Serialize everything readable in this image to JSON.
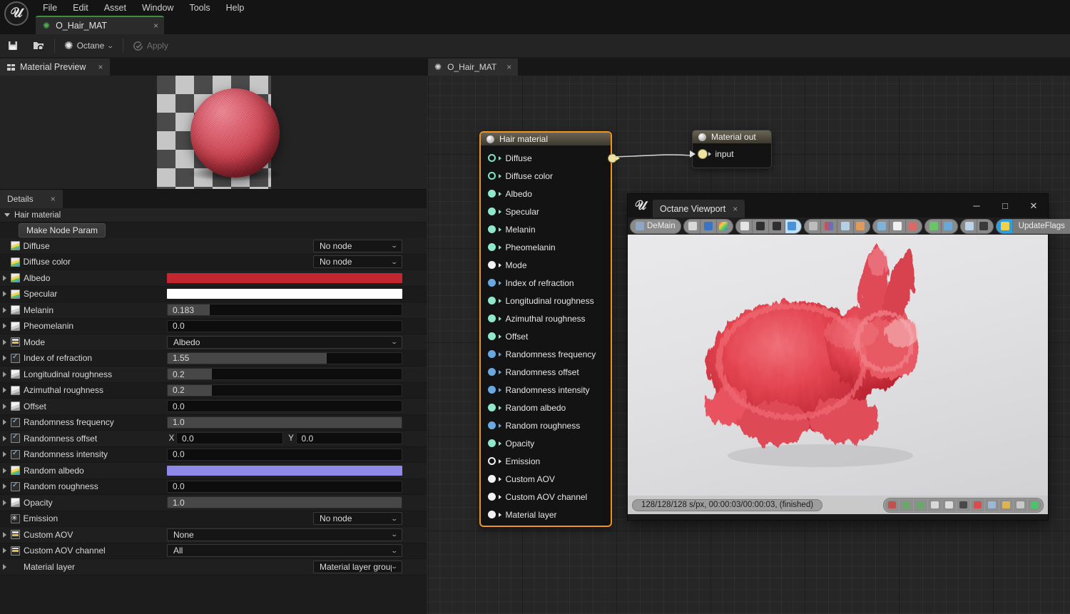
{
  "app": {
    "logo": "unreal-u-glyph",
    "menu": [
      "File",
      "Edit",
      "Asset",
      "Window",
      "Tools",
      "Help"
    ],
    "asset_tab": {
      "label": "O_Hair_MAT",
      "close": "×",
      "icon": "octane-gear-icon"
    }
  },
  "toolbar": {
    "save_label": "",
    "save_icon": "save-icon",
    "browse_icon": "browse-content-icon",
    "octane_label": "Octane",
    "octane_icon": "octane-logo-icon",
    "octane_chevron": "⌄",
    "apply_label": "Apply",
    "apply_icon": "apply-check-icon"
  },
  "preview_panel": {
    "tab_label": "Material Preview",
    "tab_close": "×",
    "tab_icon": "grid-icon"
  },
  "details_panel": {
    "tab_label": "Details",
    "tab_close": "×",
    "category": "Hair material",
    "make_node_param": "Make Node Param",
    "rows": [
      {
        "name": "Diffuse",
        "icon": "gradient-thumb-icon",
        "expand": false,
        "type": "combo",
        "value": "No node",
        "align": "right"
      },
      {
        "name": "Diffuse color",
        "icon": "gradient-thumb-icon",
        "expand": false,
        "type": "combo",
        "value": "No node",
        "align": "right"
      },
      {
        "name": "Albedo",
        "icon": "gradient-thumb-icon",
        "expand": true,
        "type": "color",
        "value": "#c42630"
      },
      {
        "name": "Specular",
        "icon": "gradient-thumb-icon",
        "expand": true,
        "type": "color",
        "value": "#ffffff"
      },
      {
        "name": "Melanin",
        "icon": "gray-thumb-icon",
        "expand": true,
        "type": "slider",
        "value": "0.183",
        "fill": 18
      },
      {
        "name": "Pheomelanin",
        "icon": "gray-thumb-icon",
        "expand": true,
        "type": "slider",
        "value": "0.0",
        "fill": 0
      },
      {
        "name": "Mode",
        "icon": "enum-bar-icon",
        "expand": true,
        "type": "combo",
        "value": "Albedo",
        "align": "full"
      },
      {
        "name": "Index of refraction",
        "icon": "check-thumb-icon",
        "expand": true,
        "type": "slider",
        "value": "1.55",
        "fill": 68
      },
      {
        "name": "Longitudinal roughness",
        "icon": "gray-thumb-icon",
        "expand": true,
        "type": "slider",
        "value": "0.2",
        "fill": 19
      },
      {
        "name": "Azimuthal roughness",
        "icon": "gray-thumb-icon",
        "expand": true,
        "type": "slider",
        "value": "0.2",
        "fill": 19
      },
      {
        "name": "Offset",
        "icon": "gray-thumb-icon",
        "expand": true,
        "type": "slider",
        "value": "0.0",
        "fill": 0
      },
      {
        "name": "Randomness frequency",
        "icon": "check-thumb-icon",
        "expand": true,
        "type": "slider",
        "value": "1.0",
        "fill": 100
      },
      {
        "name": "Randomness offset",
        "icon": "check-thumb-icon",
        "expand": true,
        "type": "xy",
        "x_label": "X",
        "x_value": "0.0",
        "y_label": "Y",
        "y_value": "0.0"
      },
      {
        "name": "Randomness intensity",
        "icon": "check-thumb-icon",
        "expand": true,
        "type": "slider",
        "value": "0.0",
        "fill": 0
      },
      {
        "name": "Random albedo",
        "icon": "gradient-thumb-icon",
        "expand": true,
        "type": "color",
        "value": "#8f8aea"
      },
      {
        "name": "Random roughness",
        "icon": "check-thumb-icon",
        "expand": true,
        "type": "slider",
        "value": "0.0",
        "fill": 0
      },
      {
        "name": "Opacity",
        "icon": "gray-thumb-icon",
        "expand": true,
        "type": "slider",
        "value": "1.0",
        "fill": 100
      },
      {
        "name": "Emission",
        "icon": "emission-icon",
        "expand": false,
        "type": "combo",
        "value": "No node",
        "align": "right"
      },
      {
        "name": "Custom AOV",
        "icon": "enum-bar-icon",
        "expand": true,
        "type": "combo",
        "value": "None",
        "align": "full"
      },
      {
        "name": "Custom AOV channel",
        "icon": "enum-bar-icon",
        "expand": true,
        "type": "combo",
        "value": "All",
        "align": "full"
      },
      {
        "name": "Material layer",
        "icon": "none",
        "expand": true,
        "type": "combo",
        "value": "Material layer group",
        "align": "right"
      }
    ]
  },
  "graph": {
    "tab_label": "O_Hair_MAT",
    "tab_close": "×",
    "tab_icon": "octane-logo-icon",
    "node": {
      "title": "Hair material",
      "selected_color": "#f0931f",
      "pins": [
        {
          "label": "Diffuse",
          "style": "hollow",
          "color": "#7fe3c4",
          "has_output": true
        },
        {
          "label": "Diffuse color",
          "style": "hollow",
          "color": "#7fe3c4"
        },
        {
          "label": "Albedo",
          "style": "solid",
          "color": "#8fe8c8"
        },
        {
          "label": "Specular",
          "style": "solid",
          "color": "#8fe8c8"
        },
        {
          "label": "Melanin",
          "style": "solid",
          "color": "#8fe8c8"
        },
        {
          "label": "Pheomelanin",
          "style": "solid",
          "color": "#8fe8c8"
        },
        {
          "label": "Mode",
          "style": "solid",
          "color": "#f2f2f2"
        },
        {
          "label": "Index of refraction",
          "style": "solid",
          "color": "#6aa8e0"
        },
        {
          "label": "Longitudinal roughness",
          "style": "solid",
          "color": "#8fe8c8"
        },
        {
          "label": "Azimuthal roughness",
          "style": "solid",
          "color": "#8fe8c8"
        },
        {
          "label": "Offset",
          "style": "solid",
          "color": "#8fe8c8"
        },
        {
          "label": "Randomness frequency",
          "style": "solid",
          "color": "#6aa8e0"
        },
        {
          "label": "Randomness offset",
          "style": "solid",
          "color": "#6aa8e0"
        },
        {
          "label": "Randomness intensity",
          "style": "solid",
          "color": "#6aa8e0"
        },
        {
          "label": "Random albedo",
          "style": "solid",
          "color": "#8fe8c8"
        },
        {
          "label": "Random roughness",
          "style": "solid",
          "color": "#6aa8e0"
        },
        {
          "label": "Opacity",
          "style": "solid",
          "color": "#8fe8c8"
        },
        {
          "label": "Emission",
          "style": "hollow",
          "color": "#f2f2f2"
        },
        {
          "label": "Custom AOV",
          "style": "solid",
          "color": "#f2f2f2"
        },
        {
          "label": "Custom AOV channel",
          "style": "solid",
          "color": "#f2f2f2"
        },
        {
          "label": "Material layer",
          "style": "solid",
          "color": "#f2f2f2"
        }
      ]
    },
    "output_node": {
      "title": "Material out",
      "input_label": "input"
    }
  },
  "octane_viewport": {
    "window_title": "Octane Viewport",
    "tab_close": "×",
    "minimize": "─",
    "maximize": "□",
    "close": "✕",
    "toolbar": {
      "camera_label": "DeMain",
      "camera_icon": "cube-icon",
      "groups": [
        {
          "buttons": [
            {
              "icon": "cube-icon",
              "label": "DeMain"
            }
          ]
        },
        {
          "buttons": [
            {
              "icon": "lightning-icon"
            },
            {
              "icon": "monitor-icon"
            },
            {
              "icon": "color-grid-icon"
            }
          ]
        },
        {
          "buttons": [
            {
              "icon": "stop-icon"
            },
            {
              "icon": "restart-icon"
            },
            {
              "icon": "pause-icon"
            },
            {
              "icon": "play-icon",
              "active": true
            }
          ]
        },
        {
          "buttons": [
            {
              "icon": "autofocus-icon"
            },
            {
              "icon": "white-balance-icon"
            },
            {
              "icon": "pick-focus-icon"
            },
            {
              "icon": "pick-material-icon"
            }
          ]
        },
        {
          "buttons": [
            {
              "icon": "region-render-icon"
            },
            {
              "icon": "checker-icon"
            },
            {
              "icon": "clay-icon"
            }
          ]
        },
        {
          "buttons": [
            {
              "icon": "save-render-icon"
            },
            {
              "icon": "save-layer-icon"
            }
          ]
        },
        {
          "buttons": [
            {
              "icon": "image-icon"
            },
            {
              "icon": "octane-logo-icon"
            }
          ]
        },
        {
          "buttons": [
            {
              "icon": "updateflags-arrows-icon",
              "blue": true
            },
            {
              "label": "UpdateFlags"
            },
            {
              "icon": "refresh-icon"
            }
          ]
        }
      ]
    },
    "render": {
      "subject": "red-furry-bunny",
      "background": "#e6e6e8"
    },
    "status": {
      "text": "128/128/128 s/px, 00:00:03/00:00:03, (finished)",
      "icons": [
        "lock-resolution-icon",
        "save-image-icon",
        "save-image-alt-icon",
        "crop-icon",
        "clock-icon",
        "network-icon",
        "red-sphere-icon",
        "blue-cube-icon",
        "gold-box-icon",
        "gradient-icon",
        "green-gear-icon"
      ]
    }
  }
}
